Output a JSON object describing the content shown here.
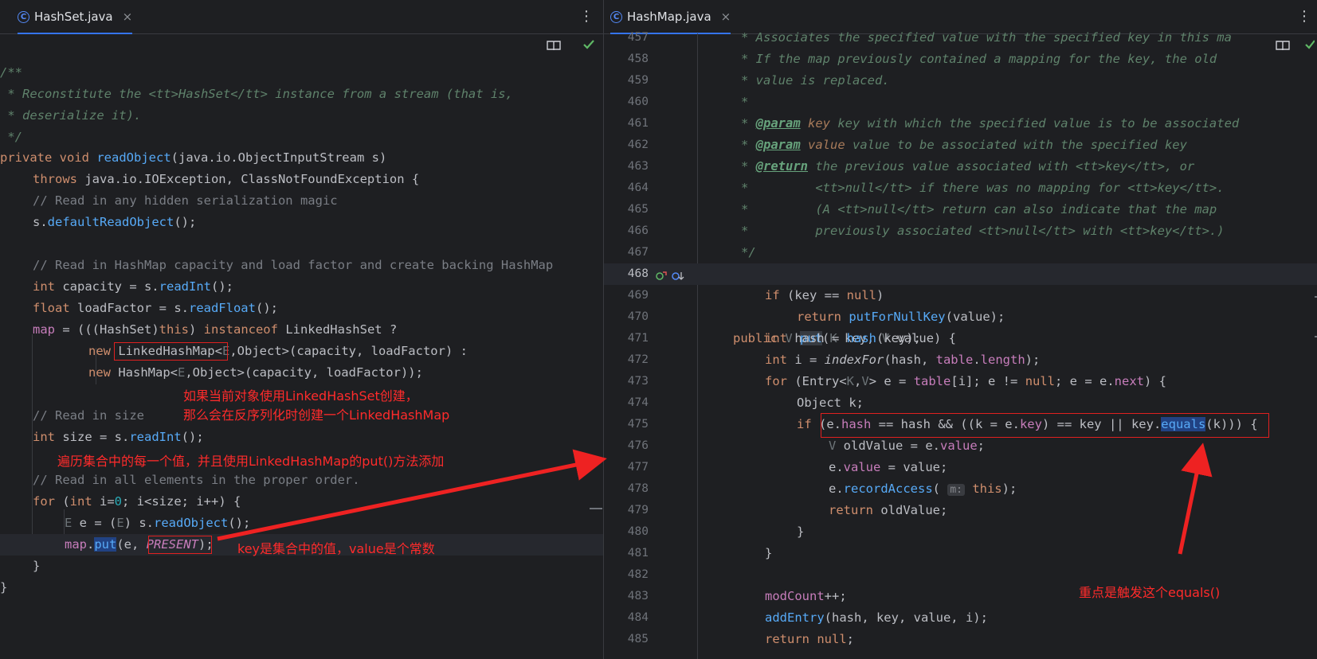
{
  "left_tab": {
    "title": "HashSet.java",
    "close": "×"
  },
  "right_tab": {
    "title": "HashMap.java",
    "close": "×"
  },
  "menu_glyph": "⋮",
  "icons": {
    "file": "java-class-icon",
    "reader": "reader-mode-icon",
    "check": "checkmark-icon"
  },
  "left_code": {
    "l01": "/**",
    "l02": " * Reconstitute the <tt>HashSet</tt> instance from a stream (that is,",
    "l03": " * deserialize it).",
    "l04": " */",
    "l05_kw": "private void ",
    "l05_fn": "readObject",
    "l05_rest": "(java.io.ObjectInputStream s)",
    "l06_kw": "throws ",
    "l06_rest": "java.io.IOException, ClassNotFoundException {",
    "l07": "// Read in any hidden serialization magic",
    "l08_a": "s.",
    "l08_m": "defaultReadObject",
    "l08_b": "();",
    "l10": "// Read in HashMap capacity and load factor and create backing HashMap",
    "l11_kw": "int ",
    "l11_a": "capacity = s.",
    "l11_m": "readInt",
    "l11_b": "();",
    "l12_kw": "float ",
    "l12_a": "loadFactor = s.",
    "l12_m": "readFloat",
    "l12_b": "();",
    "l13_f": "map",
    "l13_a": " = (((HashSet)",
    "l13_kw1": "this",
    "l13_b": ") ",
    "l13_kw2": "instanceof ",
    "l13_c": "LinkedHashSet ?",
    "l14_kw": "new ",
    "l14_a": "LinkedHashMap",
    "l14_b": "<",
    "l14_g": "E",
    "l14_c": ",Object>(capacity, loadFactor) :",
    "l15_kw": "new ",
    "l15_a": "HashMap<",
    "l15_g": "E",
    "l15_c": ",Object>(capacity, loadFactor));",
    "l17": "// Read in size",
    "l18_kw": "int ",
    "l18_a": "size = s.",
    "l18_m": "readInt",
    "l18_b": "();",
    "l20": "// Read in all elements in the proper order.",
    "l21_kw1": "for ",
    "l21_a": "(",
    "l21_kw2": "int ",
    "l21_b": "i=",
    "l21_n": "0",
    "l21_c": "; i<size; i++) {",
    "l22_g": "E",
    "l22_a": " e = (",
    "l22_g2": "E",
    "l22_b": ") s.",
    "l22_m": "readObject",
    "l22_c": "();",
    "l23_f": "map",
    "l23_a": ".",
    "l23_m": "put",
    "l23_b": "(e, ",
    "l23_p": "PRESENT",
    "l23_c": ");",
    "l24": "}",
    "l25": "}"
  },
  "right_code": {
    "n457": "457",
    "n458": "458",
    "n459": "459",
    "n460": "460",
    "n461": "461",
    "n462": "462",
    "n463": "463",
    "n464": "464",
    "n465": "465",
    "n466": "466",
    "n467": "467",
    "n468": "468",
    "n469": "469",
    "n470": "470",
    "n471": "471",
    "n472": "472",
    "n473": "473",
    "n474": "474",
    "n475": "475",
    "n476": "476",
    "n477": "477",
    "n478": "478",
    "n479": "479",
    "n480": "480",
    "n481": "481",
    "n482": "482",
    "n483": "483",
    "n484": "484",
    "n485": "485",
    "r457": "* Associates the specified value with the specified key in this ma",
    "r458": "* If the map previously contained a mapping for the key, the old",
    "r459": "* value is replaced.",
    "r460": "*",
    "r461_a": "* ",
    "r461_t": "@param",
    "r461_p": " key",
    "r461_b": " key with which the specified value is to be associated",
    "r462_a": "* ",
    "r462_t": "@param",
    "r462_p": " value",
    "r462_b": " value to be associated with the specified key",
    "r463_a": "* ",
    "r463_t": "@return",
    "r463_b": " the previous value associated with <tt>key</tt>, or",
    "r464": "*         <tt>null</tt> if there was no mapping for <tt>key</tt>.",
    "r465": "*         (A <tt>null</tt> return can also indicate that the map",
    "r466": "*         previously associated <tt>null</tt> with <tt>key</tt>.)",
    "r467": "*/",
    "r468_kw": "public ",
    "r468_g": "V ",
    "r468_m": "put",
    "r468_a": "(",
    "r468_g2": "K",
    "r468_b": " key, ",
    "r468_g3": "V",
    "r468_c": " value) {",
    "r469_kw": "if ",
    "r469_a": "(key == ",
    "r469_kw2": "null",
    "r469_b": ")",
    "r470_kw": "return ",
    "r470_m": "putForNullKey",
    "r470_a": "(value);",
    "r471_kw": "int ",
    "r471_a": "hash = ",
    "r471_m": "hash",
    "r471_b": "(key);",
    "r472_kw": "int ",
    "r472_a": "i = ",
    "r472_m": "indexFor",
    "r472_b": "(hash, ",
    "r472_f": "table",
    "r472_c": ".",
    "r472_f2": "length",
    "r472_d": ");",
    "r473_kw": "for ",
    "r473_a": "(Entry<",
    "r473_g": "K",
    "r473_b": ",",
    "r473_g2": "V",
    "r473_c": "> e = ",
    "r473_f": "table",
    "r473_d": "[i]; e != ",
    "r473_kw2": "null",
    "r473_e": "; e = e.",
    "r473_f2": "next",
    "r473_h": ") {",
    "r474": "Object k;",
    "r475_kw": "if ",
    "r475_a": "(e.",
    "r475_f": "hash",
    "r475_b": " == hash && ((k = e.",
    "r475_f2": "key",
    "r475_c": ") == key || key.",
    "r475_m": "equals",
    "r475_d": "(k))) {",
    "r476_g": "V",
    "r476_a": " oldValue = e.",
    "r476_f": "value",
    "r476_b": ";",
    "r477_a": "e.",
    "r477_f": "value",
    "r477_b": " = value;",
    "r478_a": "e.",
    "r478_m": "recordAccess",
    "r478_b": "( ",
    "r478_h": "m:",
    "r478_kw": " this",
    "r478_c": ");",
    "r479_kw": "return ",
    "r479_a": "oldValue;",
    "r480": "}",
    "r481": "}",
    "r483_f": "modCount",
    "r483_a": "++;",
    "r484_m": "addEntry",
    "r484_a": "(hash, key, value, i);",
    "r485_kw": "return ",
    "r485_kw2": "null",
    "r485_a": ";"
  },
  "annotations": {
    "note1_line1": "如果当前对象使用LinkedHashSet创建，",
    "note1_line2": "那么会在反序列化时创建一个LinkedHashMap",
    "note2": "遍历集合中的每一个值，并且使用LinkedHashMap的put()方法添加",
    "note3": "key是集合中的值，value是个常数",
    "note4": "重点是触发这个equals()",
    "color": "#ff2b2b"
  }
}
